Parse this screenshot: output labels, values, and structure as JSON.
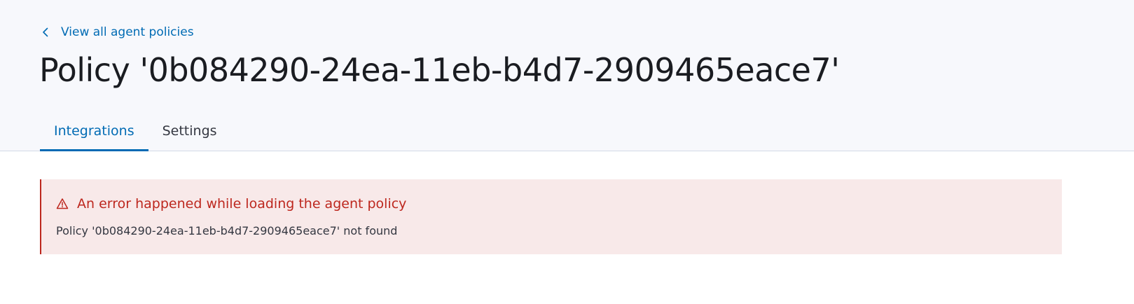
{
  "header": {
    "back_link": "View all agent policies",
    "title": "Policy '0b084290-24ea-11eb-b4d7-2909465eace7'"
  },
  "tabs": [
    {
      "label": "Integrations",
      "active": true
    },
    {
      "label": "Settings",
      "active": false
    }
  ],
  "error_callout": {
    "icon": "alert-icon",
    "title": "An error happened while loading the agent policy",
    "message": "Policy '0b084290-24ea-11eb-b4d7-2909465eace7' not found"
  },
  "colors": {
    "link": "#006bb4",
    "danger": "#bd271e",
    "danger_bg": "#f8e9e9",
    "header_bg": "#f7f8fc"
  }
}
